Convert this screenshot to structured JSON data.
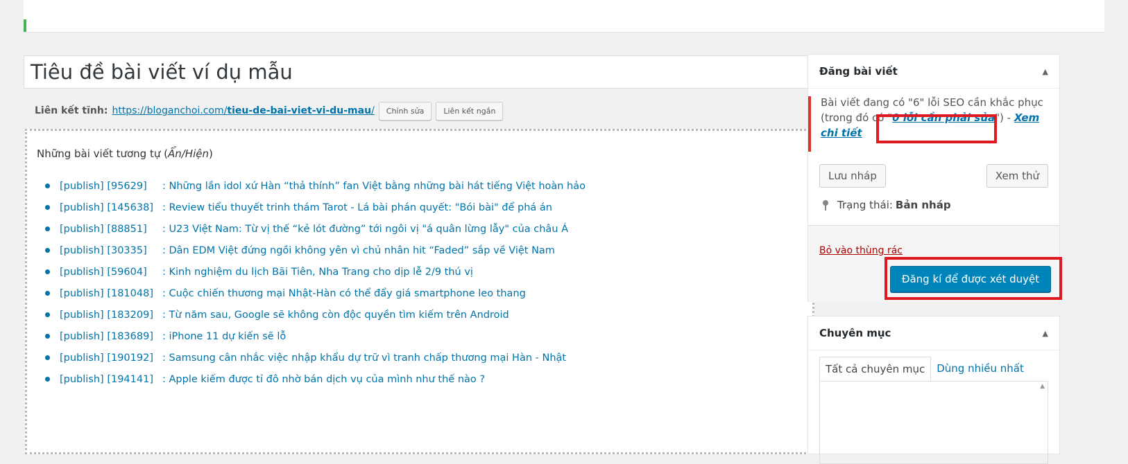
{
  "post": {
    "title": "Tiêu đề bài viết ví dụ mẫu",
    "permalink_label": "Liên kết tĩnh:",
    "permalink_base": "https://bloganchoi.com/",
    "permalink_slug": "tieu-de-bai-viet-vi-du-mau",
    "permalink_end": "/",
    "edit_button": "Chỉnh sửa",
    "shortlink_button": "Liên kết ngắn"
  },
  "related": {
    "title_prefix": "Những bài viết tương tự (",
    "title_toggle": "Ẩn/Hiện",
    "title_suffix": ")",
    "items": [
      {
        "status": "[publish] [95629]",
        "title": ": Những lần idol xứ Hàn “thả thính” fan Việt bằng những bài hát tiếng Việt hoàn hảo"
      },
      {
        "status": "[publish] [145638]",
        "title": ": Review tiểu thuyết trinh thám Tarot - Lá bài phán quyết: \"Bói bài\" để phá án"
      },
      {
        "status": "[publish] [88851]",
        "title": ": U23 Việt Nam: Từ vị thế “kẻ lót đường” tới ngôi vị \"á quân lừng lẫy\" của châu Á"
      },
      {
        "status": "[publish] [30335]",
        "title": ": Dân EDM Việt đứng ngồi không yên vì chủ nhân hit “Faded” sắp về Việt Nam"
      },
      {
        "status": "[publish] [59604]",
        "title": ": Kinh nghiệm du lịch Bãi Tiên, Nha Trang cho dịp lễ 2/9 thú vị"
      },
      {
        "status": "[publish] [181048]",
        "title": ": Cuộc chiến thương mại Nhật-Hàn có thể đẩy giá smartphone leo thang"
      },
      {
        "status": "[publish] [183209]",
        "title": ": Từ năm sau, Google sẽ không còn độc quyền tìm kiếm trên Android"
      },
      {
        "status": "[publish] [183689]",
        "title": ": iPhone 11 dự kiến sẽ lỗ"
      },
      {
        "status": "[publish] [190192]",
        "title": ": Samsung cân nhắc việc nhập khẩu dự trữ vì tranh chấp thương mại Hàn - Nhật"
      },
      {
        "status": "[publish] [194141]",
        "title": ": Apple kiếm được tỉ đô nhờ bán dịch vụ của mình như thế nào ?"
      }
    ]
  },
  "publish": {
    "heading": "Đăng bài viết",
    "seo_line1": "Bài viết đang có \"6\" lỗi SEO cần khắc phục",
    "seo_line2_prefix": "(trong đó có \"",
    "seo_link": "0 lỗi cần phải sửa",
    "seo_line2_mid": "\") - ",
    "seo_detail": "Xem chi tiết",
    "save_draft": "Lưu nháp",
    "preview": "Xem thử",
    "status_label": "Trạng thái:",
    "status_value": "Bản nháp",
    "trash": "Bỏ vào thùng rác",
    "submit": "Đăng kí để được xét duyệt"
  },
  "category": {
    "heading": "Chuyên mục",
    "tab_all": "Tất cả chuyên mục",
    "tab_popular": "Dùng nhiều nhất"
  },
  "colors": {
    "accent": "#0073aa",
    "primary_button": "#0085ba",
    "highlight": "#e01820",
    "notice_bar": "#dc3232"
  }
}
